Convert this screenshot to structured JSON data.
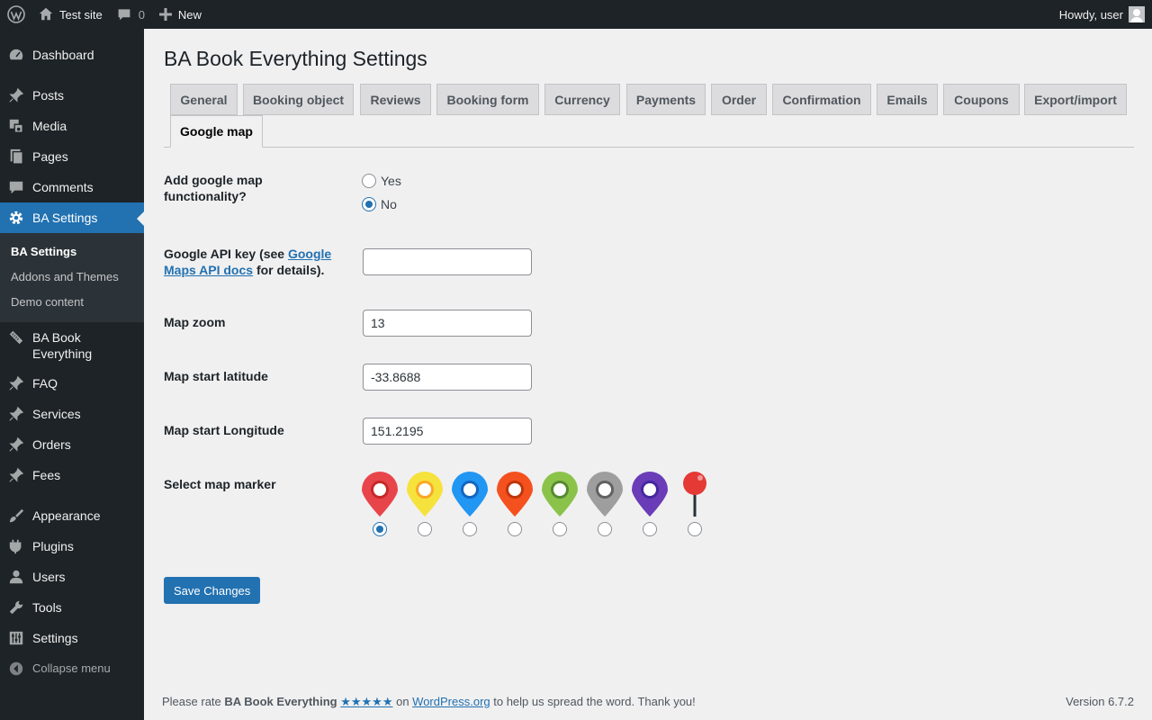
{
  "adminbar": {
    "site_name": "Test site",
    "comments_count": "0",
    "new_label": "New",
    "howdy": "Howdy, user"
  },
  "sidebar": {
    "items": [
      {
        "label": "Dashboard",
        "icon": "dashboard-icon"
      },
      {
        "label": "Posts",
        "icon": "pin-icon"
      },
      {
        "label": "Media",
        "icon": "media-icon"
      },
      {
        "label": "Pages",
        "icon": "pages-icon"
      },
      {
        "label": "Comments",
        "icon": "comment-icon"
      },
      {
        "label": "BA Settings",
        "icon": "gear-icon"
      },
      {
        "label": "BA Book Everything",
        "icon": "tag-icon"
      },
      {
        "label": "FAQ",
        "icon": "pin-icon"
      },
      {
        "label": "Services",
        "icon": "pin-icon"
      },
      {
        "label": "Orders",
        "icon": "pin-icon"
      },
      {
        "label": "Fees",
        "icon": "pin-icon"
      },
      {
        "label": "Appearance",
        "icon": "brush-icon"
      },
      {
        "label": "Plugins",
        "icon": "plugin-icon"
      },
      {
        "label": "Users",
        "icon": "user-icon"
      },
      {
        "label": "Tools",
        "icon": "wrench-icon"
      },
      {
        "label": "Settings",
        "icon": "settings-icon"
      }
    ],
    "submenu": [
      "BA Settings",
      "Addons and Themes",
      "Demo content"
    ],
    "collapse_label": "Collapse menu"
  },
  "page": {
    "title": "BA Book Everything Settings",
    "tabs": [
      "General",
      "Booking object",
      "Reviews",
      "Booking form",
      "Currency",
      "Payments",
      "Order",
      "Confirmation",
      "Emails",
      "Coupons",
      "Export/import",
      "Google map"
    ],
    "active_tab": "Google map"
  },
  "form": {
    "google_map_label": "Add google map functionality?",
    "google_map_options": [
      "Yes",
      "No"
    ],
    "google_map_selected": "No",
    "api_key_label_prefix": "Google API key (see ",
    "api_key_link": "Google Maps API docs",
    "api_key_label_suffix": " for details).",
    "api_key_value": "",
    "zoom_label": "Map zoom",
    "zoom_value": "13",
    "latitude_label": "Map start latitude",
    "latitude_value": "-33.8688",
    "longitude_label": "Map start Longitude",
    "longitude_value": "151.2195",
    "marker_label": "Select map marker",
    "markers": [
      {
        "name": "red",
        "color": "#e8454b"
      },
      {
        "name": "yellow",
        "color": "#f6e23c"
      },
      {
        "name": "blue",
        "color": "#2196f3"
      },
      {
        "name": "orange",
        "color": "#f4511e"
      },
      {
        "name": "green",
        "color": "#8bc34a"
      },
      {
        "name": "gray",
        "color": "#9e9e9e"
      },
      {
        "name": "purple",
        "color": "#6a3cb8"
      },
      {
        "name": "pushpin",
        "color": "#e53935"
      }
    ],
    "marker_selected": 0,
    "save_label": "Save Changes"
  },
  "footer": {
    "text_prefix": "Please rate ",
    "plugin_name": "BA Book Everything",
    "stars": "★★★★★",
    "text_mid": " on ",
    "wp_link": "WordPress.org",
    "text_suffix": " to help us spread the word. Thank you!",
    "version": "Version 6.7.2"
  },
  "colors": {
    "accent": "#2271b1",
    "admin_bg": "#1d2327",
    "page_bg": "#f0f0f1"
  }
}
